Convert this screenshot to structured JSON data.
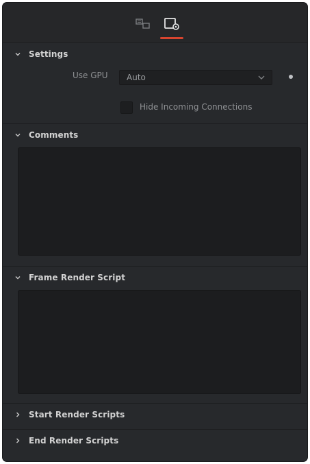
{
  "tabs": [
    {
      "name": "node-inputs-tab",
      "icon": "node-inputs-icon",
      "active": false
    },
    {
      "name": "settings-tab",
      "icon": "settings-panel-icon",
      "active": true
    }
  ],
  "accent_color": "#d8452f",
  "sections": {
    "settings": {
      "title": "Settings",
      "expanded": true,
      "use_gpu_label": "Use GPU",
      "use_gpu_value": "Auto",
      "hide_incoming_label": "Hide Incoming Connections",
      "hide_incoming_checked": false
    },
    "comments": {
      "title": "Comments",
      "expanded": true,
      "value": ""
    },
    "frame_render_script": {
      "title": "Frame Render Script",
      "expanded": true,
      "value": ""
    },
    "start_render_scripts": {
      "title": "Start Render Scripts",
      "expanded": false
    },
    "end_render_scripts": {
      "title": "End Render Scripts",
      "expanded": false
    }
  }
}
